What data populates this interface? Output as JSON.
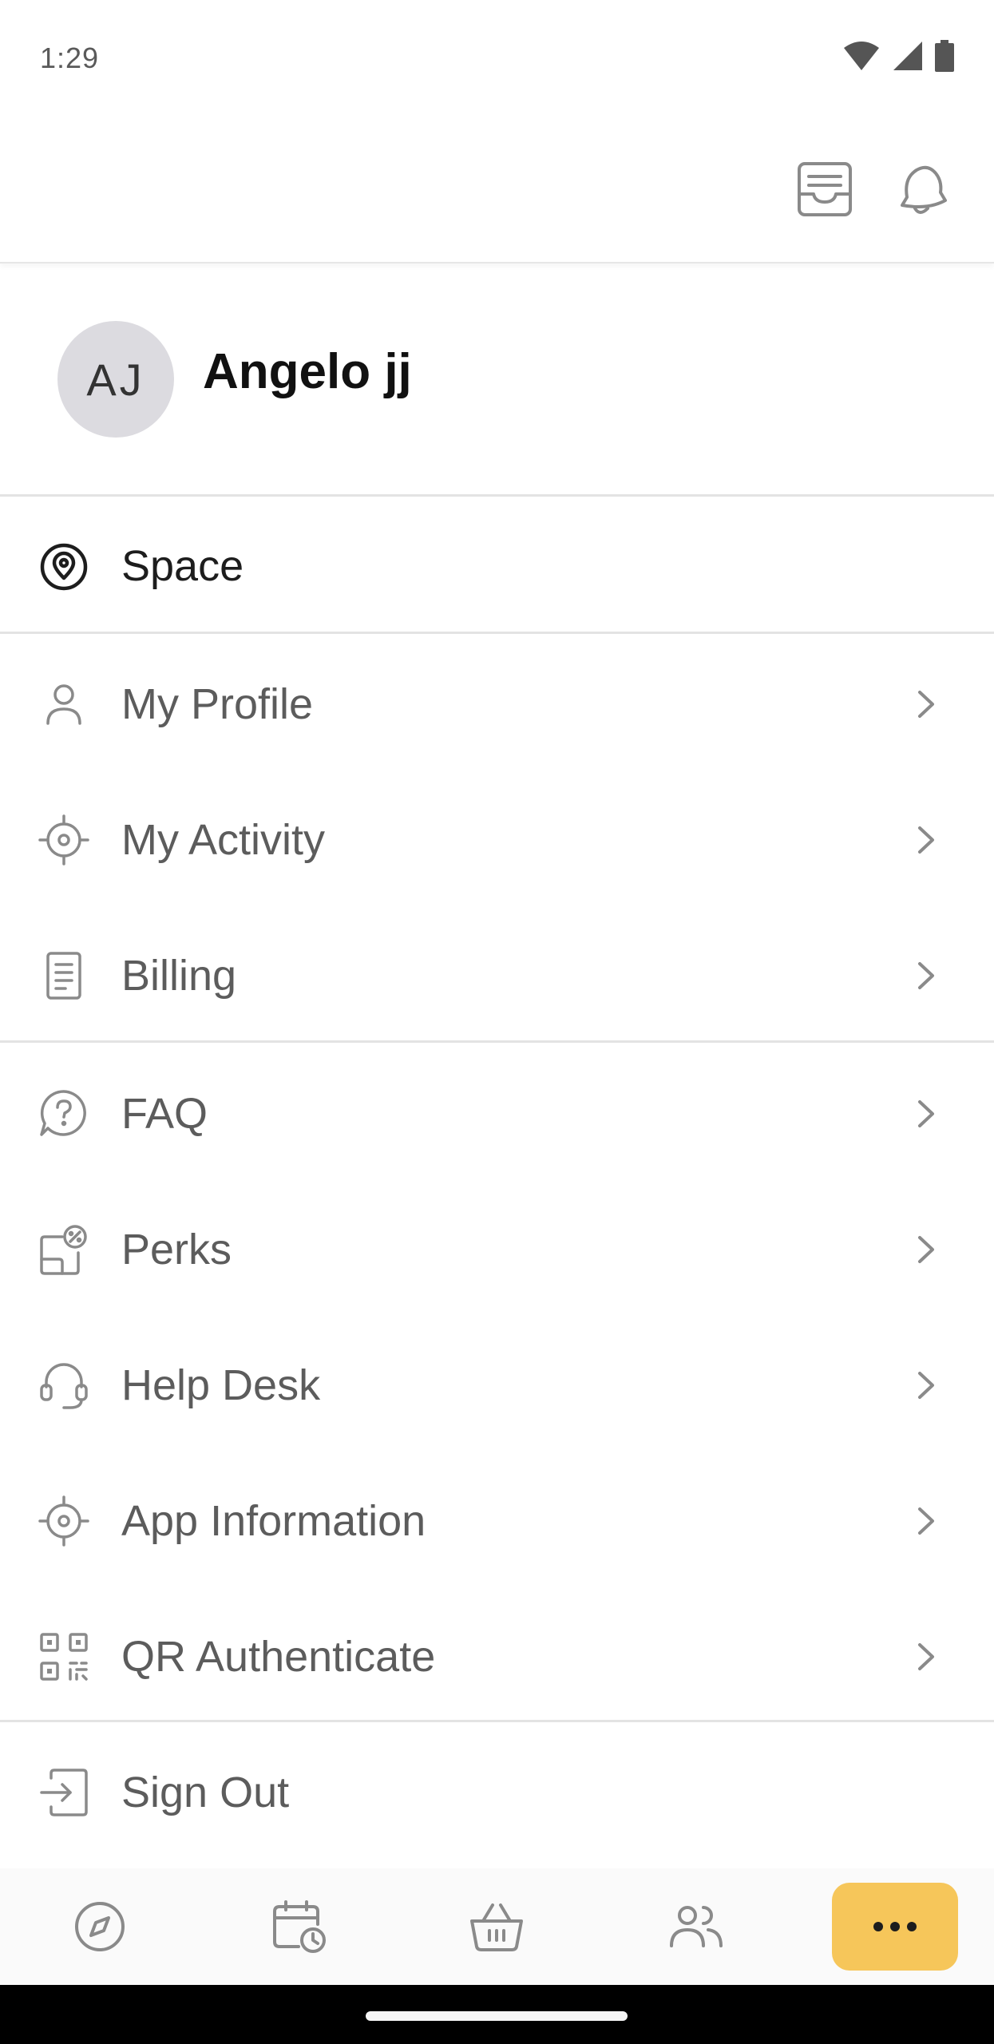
{
  "status_bar": {
    "time": "1:29",
    "icons": [
      "wifi-icon",
      "signal-icon",
      "battery-icon"
    ]
  },
  "header": {
    "icons": [
      "inbox-icon",
      "bell-icon"
    ]
  },
  "profile": {
    "initials": "AJ",
    "name": "Angelo jj"
  },
  "space": {
    "label": "Space",
    "icon": "location-pin-icon"
  },
  "menu": {
    "group1": [
      {
        "label": "My Profile",
        "icon": "user-icon"
      },
      {
        "label": "My Activity",
        "icon": "target-icon"
      },
      {
        "label": "Billing",
        "icon": "document-icon"
      }
    ],
    "group2": [
      {
        "label": "FAQ",
        "icon": "question-chat-icon"
      },
      {
        "label": "Perks",
        "icon": "discount-tag-icon"
      },
      {
        "label": "Help Desk",
        "icon": "headset-icon"
      },
      {
        "label": "App Information",
        "icon": "target-icon"
      },
      {
        "label": "QR Authenticate",
        "icon": "qr-code-icon"
      }
    ],
    "sign_out": {
      "label": "Sign Out",
      "icon": "sign-out-icon"
    }
  },
  "bottom_nav": {
    "items": [
      "compass-icon",
      "calendar-clock-icon",
      "basket-icon",
      "people-icon",
      "more-icon"
    ],
    "active": "more-icon",
    "accent_color": "#f6c65a"
  }
}
